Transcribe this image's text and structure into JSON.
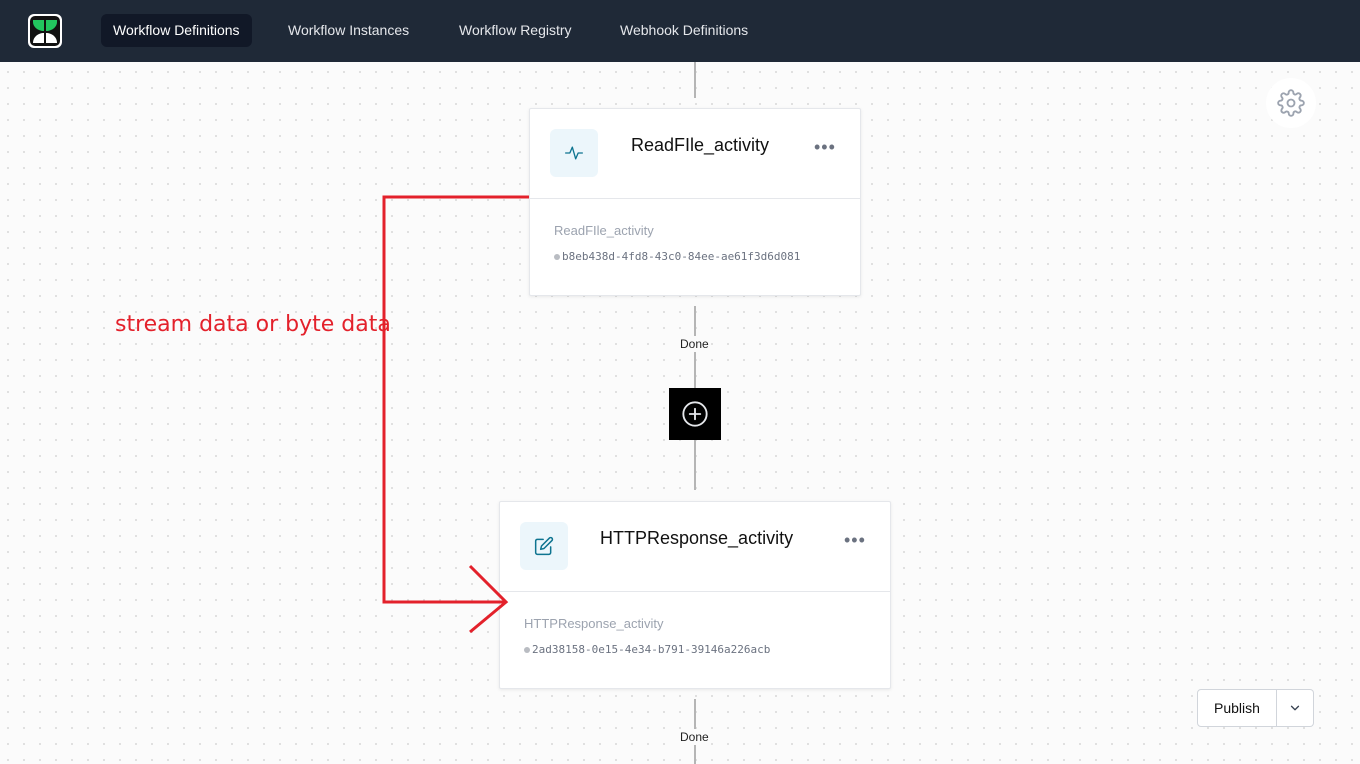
{
  "nav": {
    "items": [
      {
        "label": "Workflow Definitions",
        "active": true
      },
      {
        "label": "Workflow Instances",
        "active": false
      },
      {
        "label": "Workflow Registry",
        "active": false
      },
      {
        "label": "Webhook Definitions",
        "active": false
      }
    ]
  },
  "activities": [
    {
      "title": "ReadFIle_activity",
      "subtitle": "ReadFIle_activity",
      "id": "b8eb438d-4fd8-43c0-84ee-ae61f3d6d081",
      "icon": "activity-pulse-icon"
    },
    {
      "title": "HTTPResponse_activity",
      "subtitle": "HTTPResponse_activity",
      "id": "2ad38158-0e15-4e34-b791-39146a226acb",
      "icon": "edit-icon"
    }
  ],
  "outcomes": [
    "Done",
    "Done"
  ],
  "menu_glyph": "•••",
  "annotation": {
    "text": "stream data or byte data",
    "color": "#e3212b"
  },
  "publish": {
    "label": "Publish"
  },
  "colors": {
    "topbar": "#1f2937",
    "accent": "#0e7490"
  }
}
